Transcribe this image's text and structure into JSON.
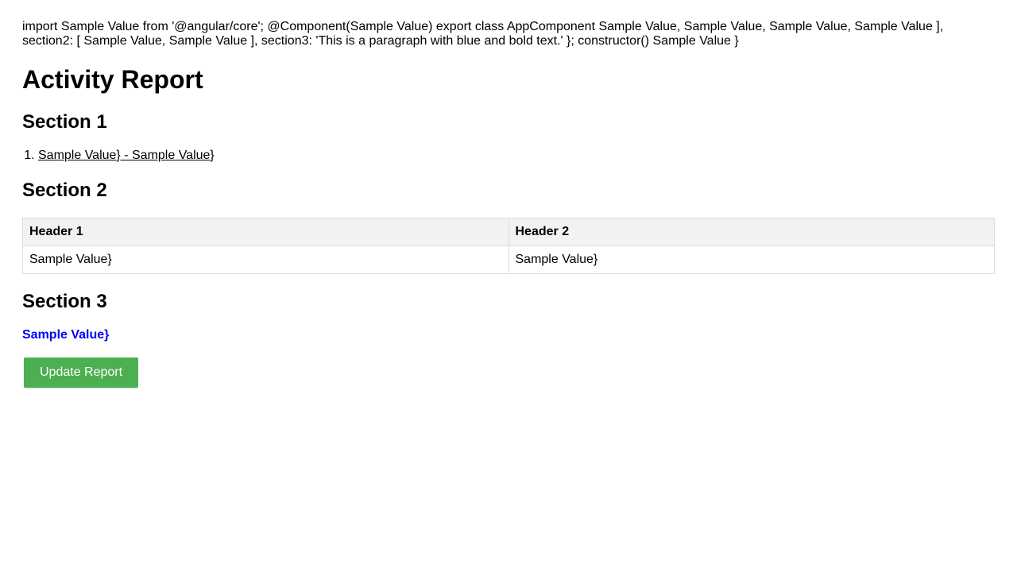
{
  "source_text": "import Sample Value from '@angular/core'; @Component(Sample Value) export class AppComponent Sample Value, Sample Value, Sample Value, Sample Value ], section2: [ Sample Value, Sample Value ], section3: 'This is a paragraph with blue and bold text.' }; constructor() Sample Value }",
  "page_title": "Activity Report",
  "section1": {
    "heading": "Section 1",
    "items": [
      {
        "number": "1.",
        "text": "Sample Value} - Sample Value}"
      }
    ]
  },
  "section2": {
    "heading": "Section 2",
    "columns": [
      "Header 1",
      "Header 2"
    ],
    "rows": [
      [
        "Sample Value}",
        "Sample Value}"
      ]
    ]
  },
  "section3": {
    "heading": "Section 3",
    "text": "Sample Value}",
    "text_color": "#0000ff"
  },
  "button": {
    "label": "Update Report",
    "color": "#4caf50"
  }
}
